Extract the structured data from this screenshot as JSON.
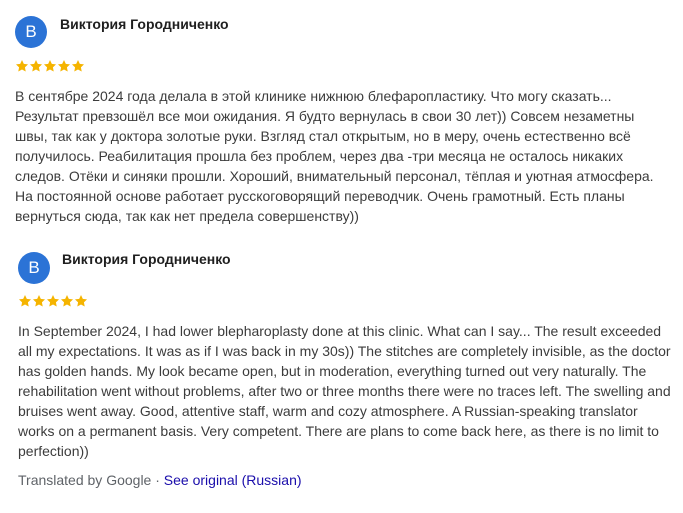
{
  "reviews": [
    {
      "avatar_letter": "В",
      "name": "Виктория Городниченко",
      "rating": 5,
      "text_lines": [
        "В сентябре 2024 года делала в этой клинике нижнюю блефаропластику. Что могу сказать...",
        "Результат превзошёл все мои ожидания. Я будто вернулась в свои 30 лет)) Совсем незаметны",
        "швы, так как у доктора золотые руки. Взгляд стал открытым, но в меру, очень естественно всё",
        "получилось. Реабилитация прошла без проблем, через два -три месяца не осталось никаких",
        "следов. Отёки и синяки прошли. Хороший, внимательный персонал, тёплая и уютная атмосфера.",
        "На постоянной основе работает русскоговорящий переводчик. Очень грамотный. Есть планы",
        "вернуться сюда, так как нет предела совершенству))"
      ]
    },
    {
      "avatar_letter": "В",
      "name": "Виктория Городниченко",
      "rating": 5,
      "text_lines": [
        "In September 2024, I had lower blepharoplasty done at this clinic. What can I say... The result exceeded",
        "all my expectations. It was as if I was back in my 30s)) The stitches are completely invisible, as the doctor",
        "has golden hands. My look became open, but in moderation, everything turned out very naturally. The",
        "rehabilitation went without problems, after two or three months there were no traces left. The swelling and",
        "bruises went away. Good, attentive staff, warm and cozy atmosphere. A Russian-speaking translator",
        "works on a permanent basis. Very competent. There are plans to come back here, as there is no limit to",
        "perfection))"
      ]
    }
  ],
  "footer": {
    "translated_by": "Translated by Google",
    "separator": " · ",
    "see_original": "See original (Russian)"
  },
  "colors": {
    "avatar": "#2b73d6",
    "star": "#f5b400",
    "link": "#1a0dab"
  }
}
